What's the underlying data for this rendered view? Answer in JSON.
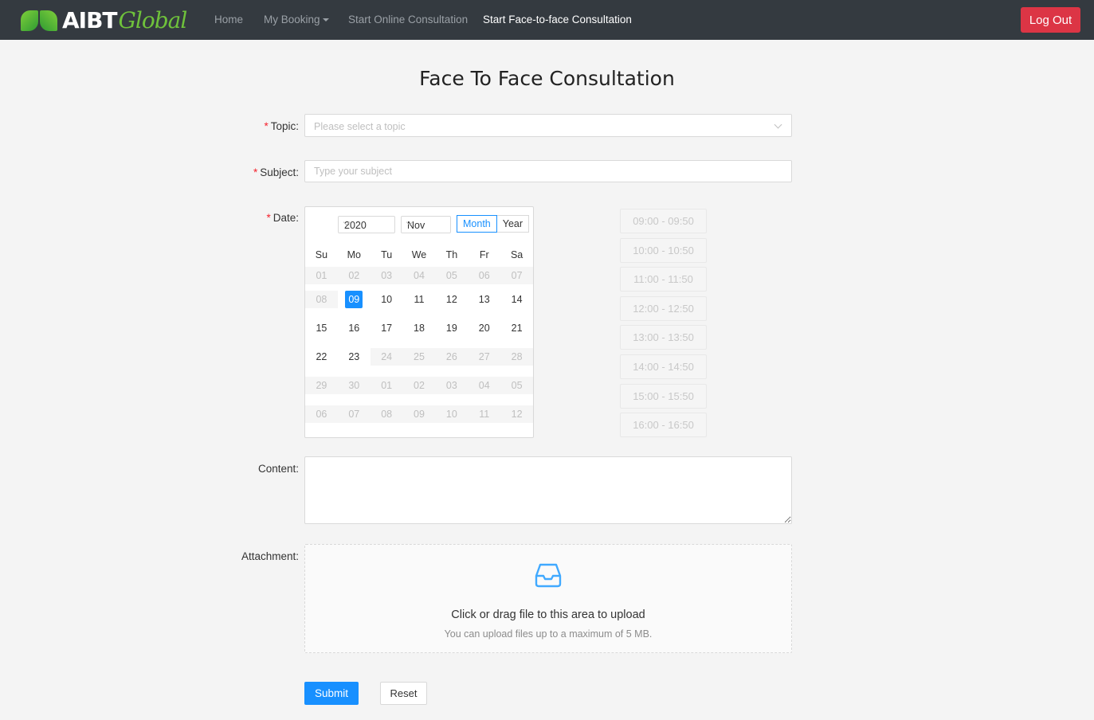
{
  "nav": {
    "logo_main": "AIBT",
    "logo_script": "Global",
    "items": [
      {
        "label": "Home"
      },
      {
        "label": "My Booking"
      },
      {
        "label": "Start Online Consultation"
      },
      {
        "label": "Start Face-to-face Consultation"
      }
    ],
    "logout_label": "Log Out",
    "logout_color": "#dc3545"
  },
  "page_title": "Face To Face Consultation",
  "form": {
    "topic": {
      "label": "Topic:",
      "placeholder": "Please select a topic"
    },
    "subject": {
      "label": "Subject:",
      "placeholder": "Type your subject"
    },
    "date": {
      "label": "Date:"
    },
    "content": {
      "label": "Content:"
    },
    "attachment": {
      "label": "Attachment:",
      "text": "Click or drag file to this area to upload",
      "hint": "You can upload files up to a maximum of 5 MB."
    },
    "submit_label": "Submit",
    "reset_label": "Reset"
  },
  "calendar": {
    "year": "2020",
    "month": "Nov",
    "mode_month": "Month",
    "mode_year": "Year",
    "weekdays": [
      "Su",
      "Mo",
      "Tu",
      "We",
      "Th",
      "Fr",
      "Sa"
    ],
    "weeks": [
      [
        {
          "d": "01",
          "dis": true
        },
        {
          "d": "02",
          "dis": true
        },
        {
          "d": "03",
          "dis": true
        },
        {
          "d": "04",
          "dis": true
        },
        {
          "d": "05",
          "dis": true
        },
        {
          "d": "06",
          "dis": true
        },
        {
          "d": "07",
          "dis": true
        }
      ],
      [
        {
          "d": "08",
          "dis": true
        },
        {
          "d": "09",
          "sel": true
        },
        {
          "d": "10"
        },
        {
          "d": "11"
        },
        {
          "d": "12"
        },
        {
          "d": "13"
        },
        {
          "d": "14"
        }
      ],
      [
        {
          "d": "15"
        },
        {
          "d": "16"
        },
        {
          "d": "17"
        },
        {
          "d": "18"
        },
        {
          "d": "19"
        },
        {
          "d": "20"
        },
        {
          "d": "21"
        }
      ],
      [
        {
          "d": "22"
        },
        {
          "d": "23"
        },
        {
          "d": "24",
          "dis": true
        },
        {
          "d": "25",
          "dis": true
        },
        {
          "d": "26",
          "dis": true
        },
        {
          "d": "27",
          "dis": true
        },
        {
          "d": "28",
          "dis": true
        }
      ],
      [
        {
          "d": "29",
          "dis": true
        },
        {
          "d": "30",
          "dis": true
        },
        {
          "d": "01",
          "dis": true
        },
        {
          "d": "02",
          "dis": true
        },
        {
          "d": "03",
          "dis": true
        },
        {
          "d": "04",
          "dis": true
        },
        {
          "d": "05",
          "dis": true
        }
      ],
      [
        {
          "d": "06",
          "dis": true
        },
        {
          "d": "07",
          "dis": true
        },
        {
          "d": "08",
          "dis": true
        },
        {
          "d": "09",
          "dis": true
        },
        {
          "d": "10",
          "dis": true
        },
        {
          "d": "11",
          "dis": true
        },
        {
          "d": "12",
          "dis": true
        }
      ]
    ]
  },
  "time_slots": [
    "09:00 - 09:50",
    "10:00 - 10:50",
    "11:00 - 11:50",
    "12:00 - 12:50",
    "13:00 - 13:50",
    "14:00 - 14:50",
    "15:00 - 15:50",
    "16:00 - 16:50"
  ],
  "colors": {
    "primary": "#1890ff",
    "navbar": "#343a40",
    "required": "#f5222d"
  }
}
